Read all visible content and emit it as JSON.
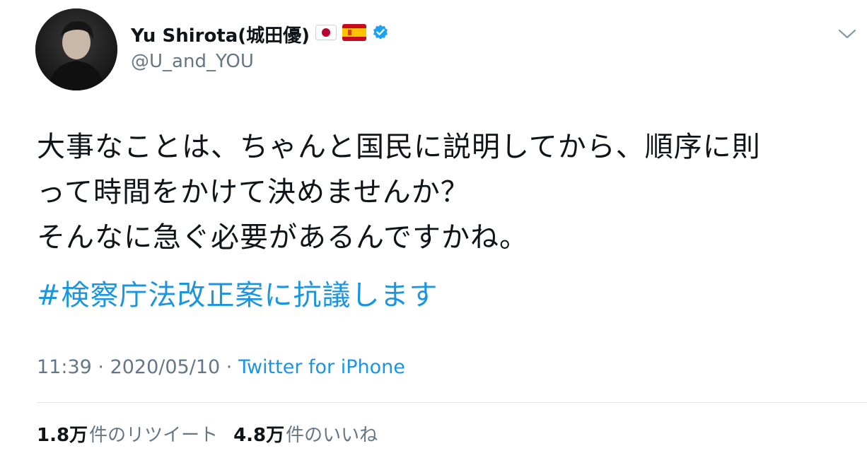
{
  "author": {
    "display_name": "Yu Shirota(城田優)",
    "handle": "@U_and_YOU",
    "flags": [
      "japan-flag-icon",
      "spain-flag-icon"
    ],
    "verified": true
  },
  "tweet": {
    "lines": [
      "大事なことは、ちゃんと国民に説明してから、順序に則",
      "って時間をかけて決めませんか？",
      "そんなに急ぐ必要があるんですかね。"
    ],
    "hashtag": "#検察庁法改正案に抗議します"
  },
  "meta": {
    "time": "11:39",
    "separator1": " · ",
    "date": "2020/05/10",
    "separator2": " · ",
    "source": "Twitter for iPhone"
  },
  "stats": {
    "retweets_count": "1.8万",
    "retweets_label": "件のリツイート",
    "likes_count": "4.8万",
    "likes_label": "件のいいね"
  },
  "colors": {
    "link": "#1b95e0",
    "muted": "#657786",
    "text": "#0f1419",
    "verified": "#1da1f2",
    "divider": "#e1e8ed"
  }
}
